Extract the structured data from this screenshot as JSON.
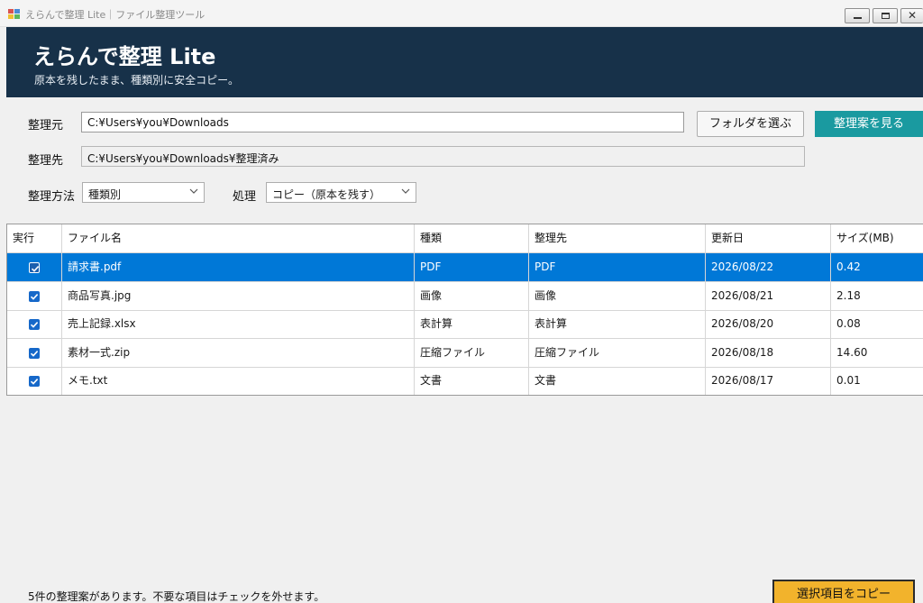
{
  "window": {
    "title": "えらんで整理 Lite｜ファイル整理ツール",
    "minimize_label": "",
    "maximize_label": "",
    "close_label": "✕"
  },
  "header": {
    "title": "えらんで整理 Lite",
    "subtitle": "原本を残したまま、種類別に安全コピー。",
    "background": "#173149"
  },
  "form": {
    "source_label": "整理元",
    "source_value": "C:¥Users¥you¥Downloads",
    "choose_folder_button": "フォルダを選ぶ",
    "preview_button": "整理案を見る",
    "dest_label": "整理先",
    "dest_value": "C:¥Users¥you¥Downloads¥整理済み",
    "method_label": "整理方法",
    "method_value": "種類別",
    "action_label": "処理",
    "action_value": "コピー（原本を残す）"
  },
  "table": {
    "columns": [
      "実行",
      "ファイル名",
      "種類",
      "整理先",
      "更新日",
      "サイズ(MB)"
    ],
    "rows": [
      {
        "checked": true,
        "name": "請求書.pdf",
        "type": "PDF",
        "dest": "PDF",
        "date": "2026/08/22",
        "size": "0.42",
        "selected": true
      },
      {
        "checked": true,
        "name": "商品写真.jpg",
        "type": "画像",
        "dest": "画像",
        "date": "2026/08/21",
        "size": "2.18",
        "selected": false
      },
      {
        "checked": true,
        "name": "売上記録.xlsx",
        "type": "表計算",
        "dest": "表計算",
        "date": "2026/08/20",
        "size": "0.08",
        "selected": false
      },
      {
        "checked": true,
        "name": "素材一式.zip",
        "type": "圧縮ファイル",
        "dest": "圧縮ファイル",
        "date": "2026/08/18",
        "size": "14.60",
        "selected": false
      },
      {
        "checked": true,
        "name": "メモ.txt",
        "type": "文書",
        "dest": "文書",
        "date": "2026/08/17",
        "size": "0.01",
        "selected": false
      }
    ]
  },
  "footer": {
    "status": "5件の整理案があります。不要な項目はチェックを外せます。",
    "copy_button": "選択項目をコピー"
  },
  "colors": {
    "accent_teal": "#1a9aa0",
    "selection_blue": "#0078d7",
    "action_orange": "#f2b32c"
  }
}
